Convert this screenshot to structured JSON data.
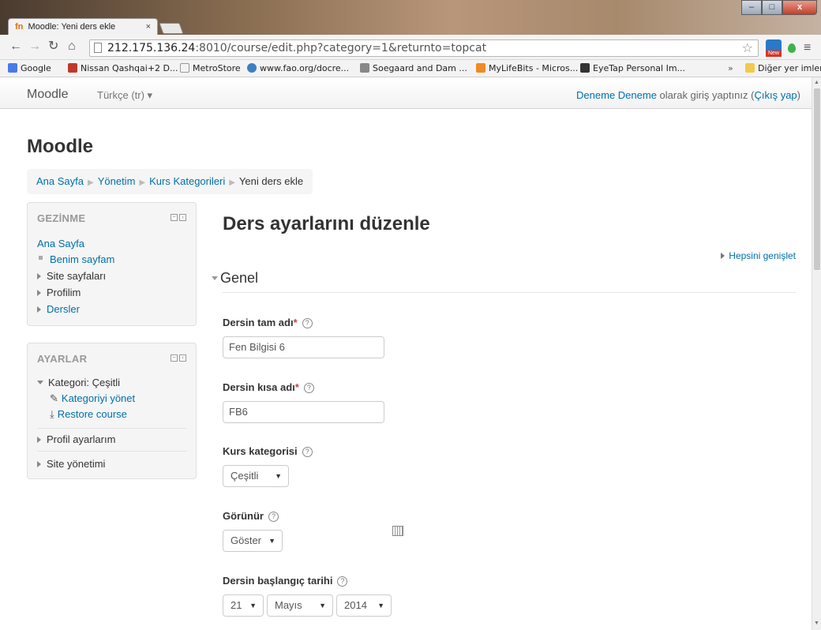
{
  "browser": {
    "tab_title": "Moodle: Yeni ders ekle",
    "tab_favicon": "fn",
    "tab_close": "×",
    "url_host": "212.175.136.24",
    "url_rest": ":8010/course/edit.php?category=1&returnto=topcat",
    "ext_badge": "New",
    "bookmarks": [
      {
        "label": "Google",
        "color": "#4a7ae8"
      },
      {
        "label": "Nissan Qashqai+2 D...",
        "color": "#c0392b"
      },
      {
        "label": "MetroStore",
        "color": "#ffffff"
      },
      {
        "label": "www.fao.org/docre...",
        "color": "#3b7fc4"
      },
      {
        "label": "Soegaard and Dam ...",
        "color": "#888888"
      },
      {
        "label": "MyLifeBits - Micros...",
        "color": "#f08a24"
      },
      {
        "label": "EyeTap Personal Im...",
        "color": "#333333"
      }
    ],
    "bookmarks_more": "»",
    "other_bookmarks": "Diğer yer imleri"
  },
  "navbar": {
    "brand": "Moodle",
    "language": "Türkçe (tr) ▾",
    "user": "Deneme Deneme",
    "login_text": " olarak giriş yaptınız (",
    "logout": "Çıkış yap",
    "close_paren": ")"
  },
  "site_title": "Moodle",
  "breadcrumb": [
    "Ana Sayfa",
    "Yönetim",
    "Kurs Kategorileri",
    "Yeni ders ekle"
  ],
  "nav_block": {
    "title": "GEZİNME",
    "home": "Ana Sayfa",
    "items": [
      "Benim sayfam",
      "Site sayfaları",
      "Profilim",
      "Dersler"
    ]
  },
  "settings_block": {
    "title": "AYARLAR",
    "category": "Kategori: Çeşitli",
    "manage_category": "Kategoriyi yönet",
    "restore_course": "Restore course",
    "profile_settings": "Profil ayarlarım",
    "site_admin": "Site yönetimi"
  },
  "main": {
    "heading": "Ders ayarlarını düzenle",
    "expand_all": "Hepsini genişlet",
    "section": "Genel",
    "fullname_label": "Dersin tam adı",
    "fullname_value": "Fen Bilgisi 6",
    "shortname_label": "Dersin kısa adı",
    "shortname_value": "FB6",
    "required_mark": "*",
    "help_mark": "?",
    "category_label": "Kurs kategorisi",
    "category_value": "Çeşitli",
    "visible_label": "Görünür",
    "visible_value": "Göster",
    "startdate_label": "Dersin başlangıç tarihi",
    "start_day": "21",
    "start_month": "Mayıs",
    "start_year": "2014",
    "caret": "▼"
  }
}
